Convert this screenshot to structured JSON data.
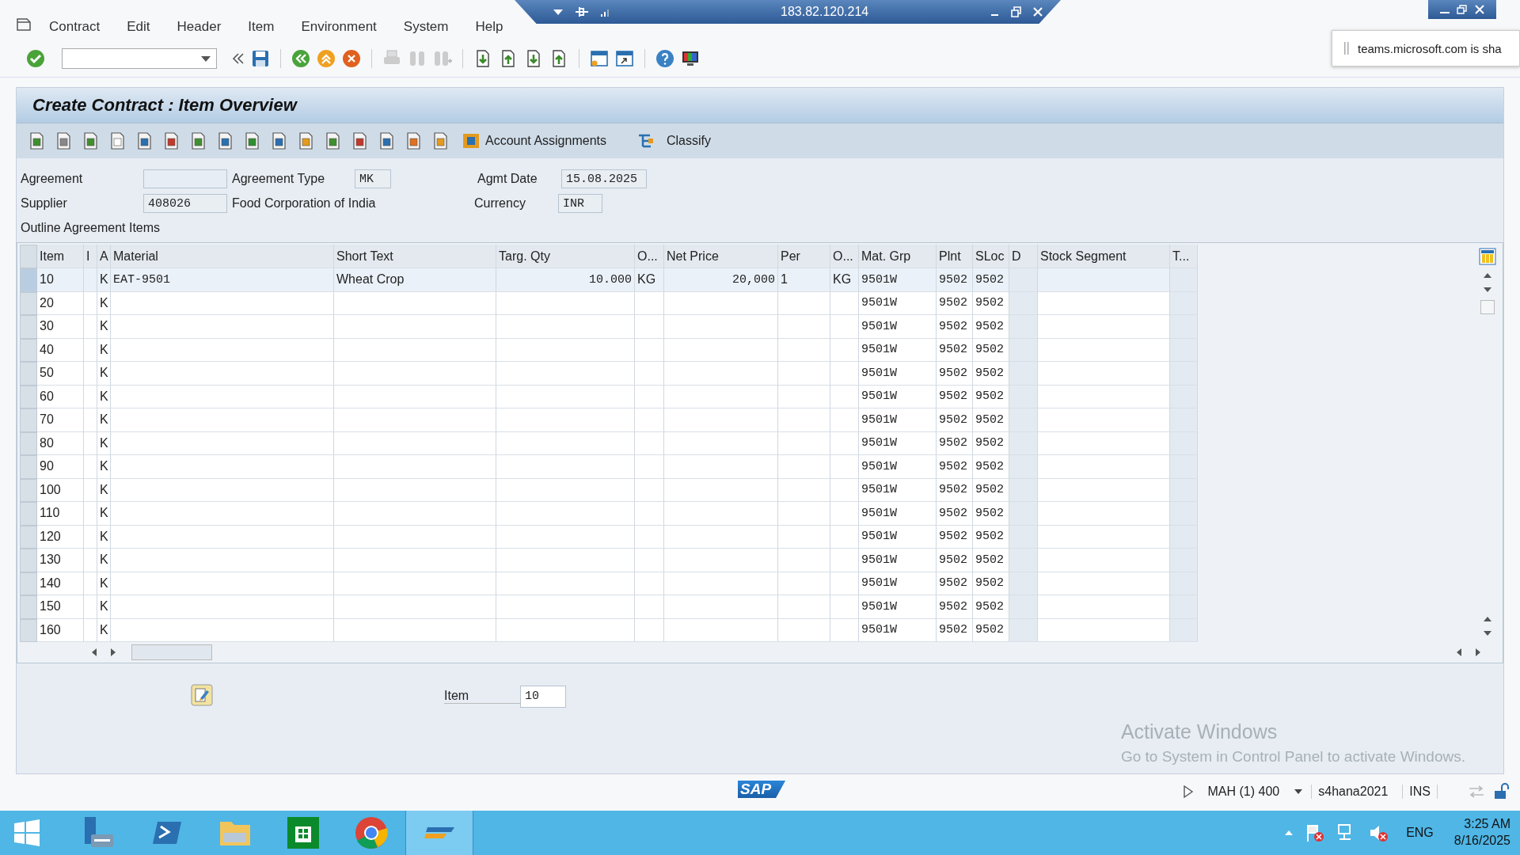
{
  "remote_session": {
    "title": "183.82.120.214"
  },
  "menu": [
    {
      "label": "Contract"
    },
    {
      "label": "Edit"
    },
    {
      "label": "Header"
    },
    {
      "label": "Item"
    },
    {
      "label": "Environment"
    },
    {
      "label": "System"
    },
    {
      "label": "Help"
    }
  ],
  "notification": {
    "text": "teams.microsoft.com is sha"
  },
  "title": "Create Contract : Item Overview",
  "app_toolbar": [
    {
      "label": "Account Assignments"
    },
    {
      "label": "Classify"
    }
  ],
  "form": {
    "agreement": {
      "label": "Agreement"
    },
    "agreement_type": {
      "label": "Agreement Type",
      "value": "MK"
    },
    "agmt_date": {
      "label": "Agmt Date",
      "value": "15.08.2025"
    },
    "supplier": {
      "label": "Supplier",
      "value": "408026",
      "name": "Food Corporation of India"
    },
    "currency": {
      "label": "Currency",
      "value": "INR"
    }
  },
  "section_label": "Outline Agreement Items",
  "table": {
    "columns": [
      "Item",
      "I",
      "A",
      "Material",
      "Short Text",
      "Targ. Qty",
      "O...",
      "Net Price",
      "Per",
      "O...",
      "Mat. Grp",
      "Plnt",
      "SLoc",
      "D",
      "Stock Segment",
      "T..."
    ],
    "rows": [
      {
        "selected": true,
        "item": "10",
        "a": "K",
        "material": "EAT-9501",
        "short_text": "Wheat Crop",
        "targ_qty": "10.000",
        "order_unit": "KG",
        "net_price": "20,000",
        "per": "1",
        "price_unit": "KG",
        "mat_grp": "9501W",
        "plnt": "9502",
        "sloc": "9502"
      },
      {
        "selected": false,
        "item": "20",
        "a": "K",
        "mat_grp": "9501W",
        "plnt": "9502",
        "sloc": "9502"
      },
      {
        "selected": false,
        "item": "30",
        "a": "K",
        "mat_grp": "9501W",
        "plnt": "9502",
        "sloc": "9502"
      },
      {
        "selected": false,
        "item": "40",
        "a": "K",
        "mat_grp": "9501W",
        "plnt": "9502",
        "sloc": "9502"
      },
      {
        "selected": false,
        "item": "50",
        "a": "K",
        "mat_grp": "9501W",
        "plnt": "9502",
        "sloc": "9502"
      },
      {
        "selected": false,
        "item": "60",
        "a": "K",
        "mat_grp": "9501W",
        "plnt": "9502",
        "sloc": "9502"
      },
      {
        "selected": false,
        "item": "70",
        "a": "K",
        "mat_grp": "9501W",
        "plnt": "9502",
        "sloc": "9502"
      },
      {
        "selected": false,
        "item": "80",
        "a": "K",
        "mat_grp": "9501W",
        "plnt": "9502",
        "sloc": "9502"
      },
      {
        "selected": false,
        "item": "90",
        "a": "K",
        "mat_grp": "9501W",
        "plnt": "9502",
        "sloc": "9502"
      },
      {
        "selected": false,
        "item": "100",
        "a": "K",
        "mat_grp": "9501W",
        "plnt": "9502",
        "sloc": "9502"
      },
      {
        "selected": false,
        "item": "110",
        "a": "K",
        "mat_grp": "9501W",
        "plnt": "9502",
        "sloc": "9502"
      },
      {
        "selected": false,
        "item": "120",
        "a": "K",
        "mat_grp": "9501W",
        "plnt": "9502",
        "sloc": "9502"
      },
      {
        "selected": false,
        "item": "130",
        "a": "K",
        "mat_grp": "9501W",
        "plnt": "9502",
        "sloc": "9502"
      },
      {
        "selected": false,
        "item": "140",
        "a": "K",
        "mat_grp": "9501W",
        "plnt": "9502",
        "sloc": "9502"
      },
      {
        "selected": false,
        "item": "150",
        "a": "K",
        "mat_grp": "9501W",
        "plnt": "9502",
        "sloc": "9502"
      },
      {
        "selected": false,
        "item": "160",
        "a": "K",
        "mat_grp": "9501W",
        "plnt": "9502",
        "sloc": "9502"
      }
    ]
  },
  "detail": {
    "label": "Item",
    "value": "10"
  },
  "activation_notice": {
    "title": "Activate Windows",
    "text": "Go to System in Control Panel to activate Windows."
  },
  "status_bar": {
    "logo": "SAP",
    "session": "MAH (1) 400",
    "server": "s4hana2021",
    "mode": "INS"
  },
  "taskbar": {
    "apps": [
      {
        "kind": "server",
        "selected": false
      },
      {
        "kind": "shell",
        "selected": false
      },
      {
        "kind": "folder",
        "selected": false
      },
      {
        "kind": "store",
        "selected": false
      },
      {
        "kind": "browser",
        "selected": false
      },
      {
        "kind": "sap",
        "selected": true
      }
    ],
    "language": "ENG",
    "time": "3:25 AM",
    "date": "8/16/2025"
  }
}
